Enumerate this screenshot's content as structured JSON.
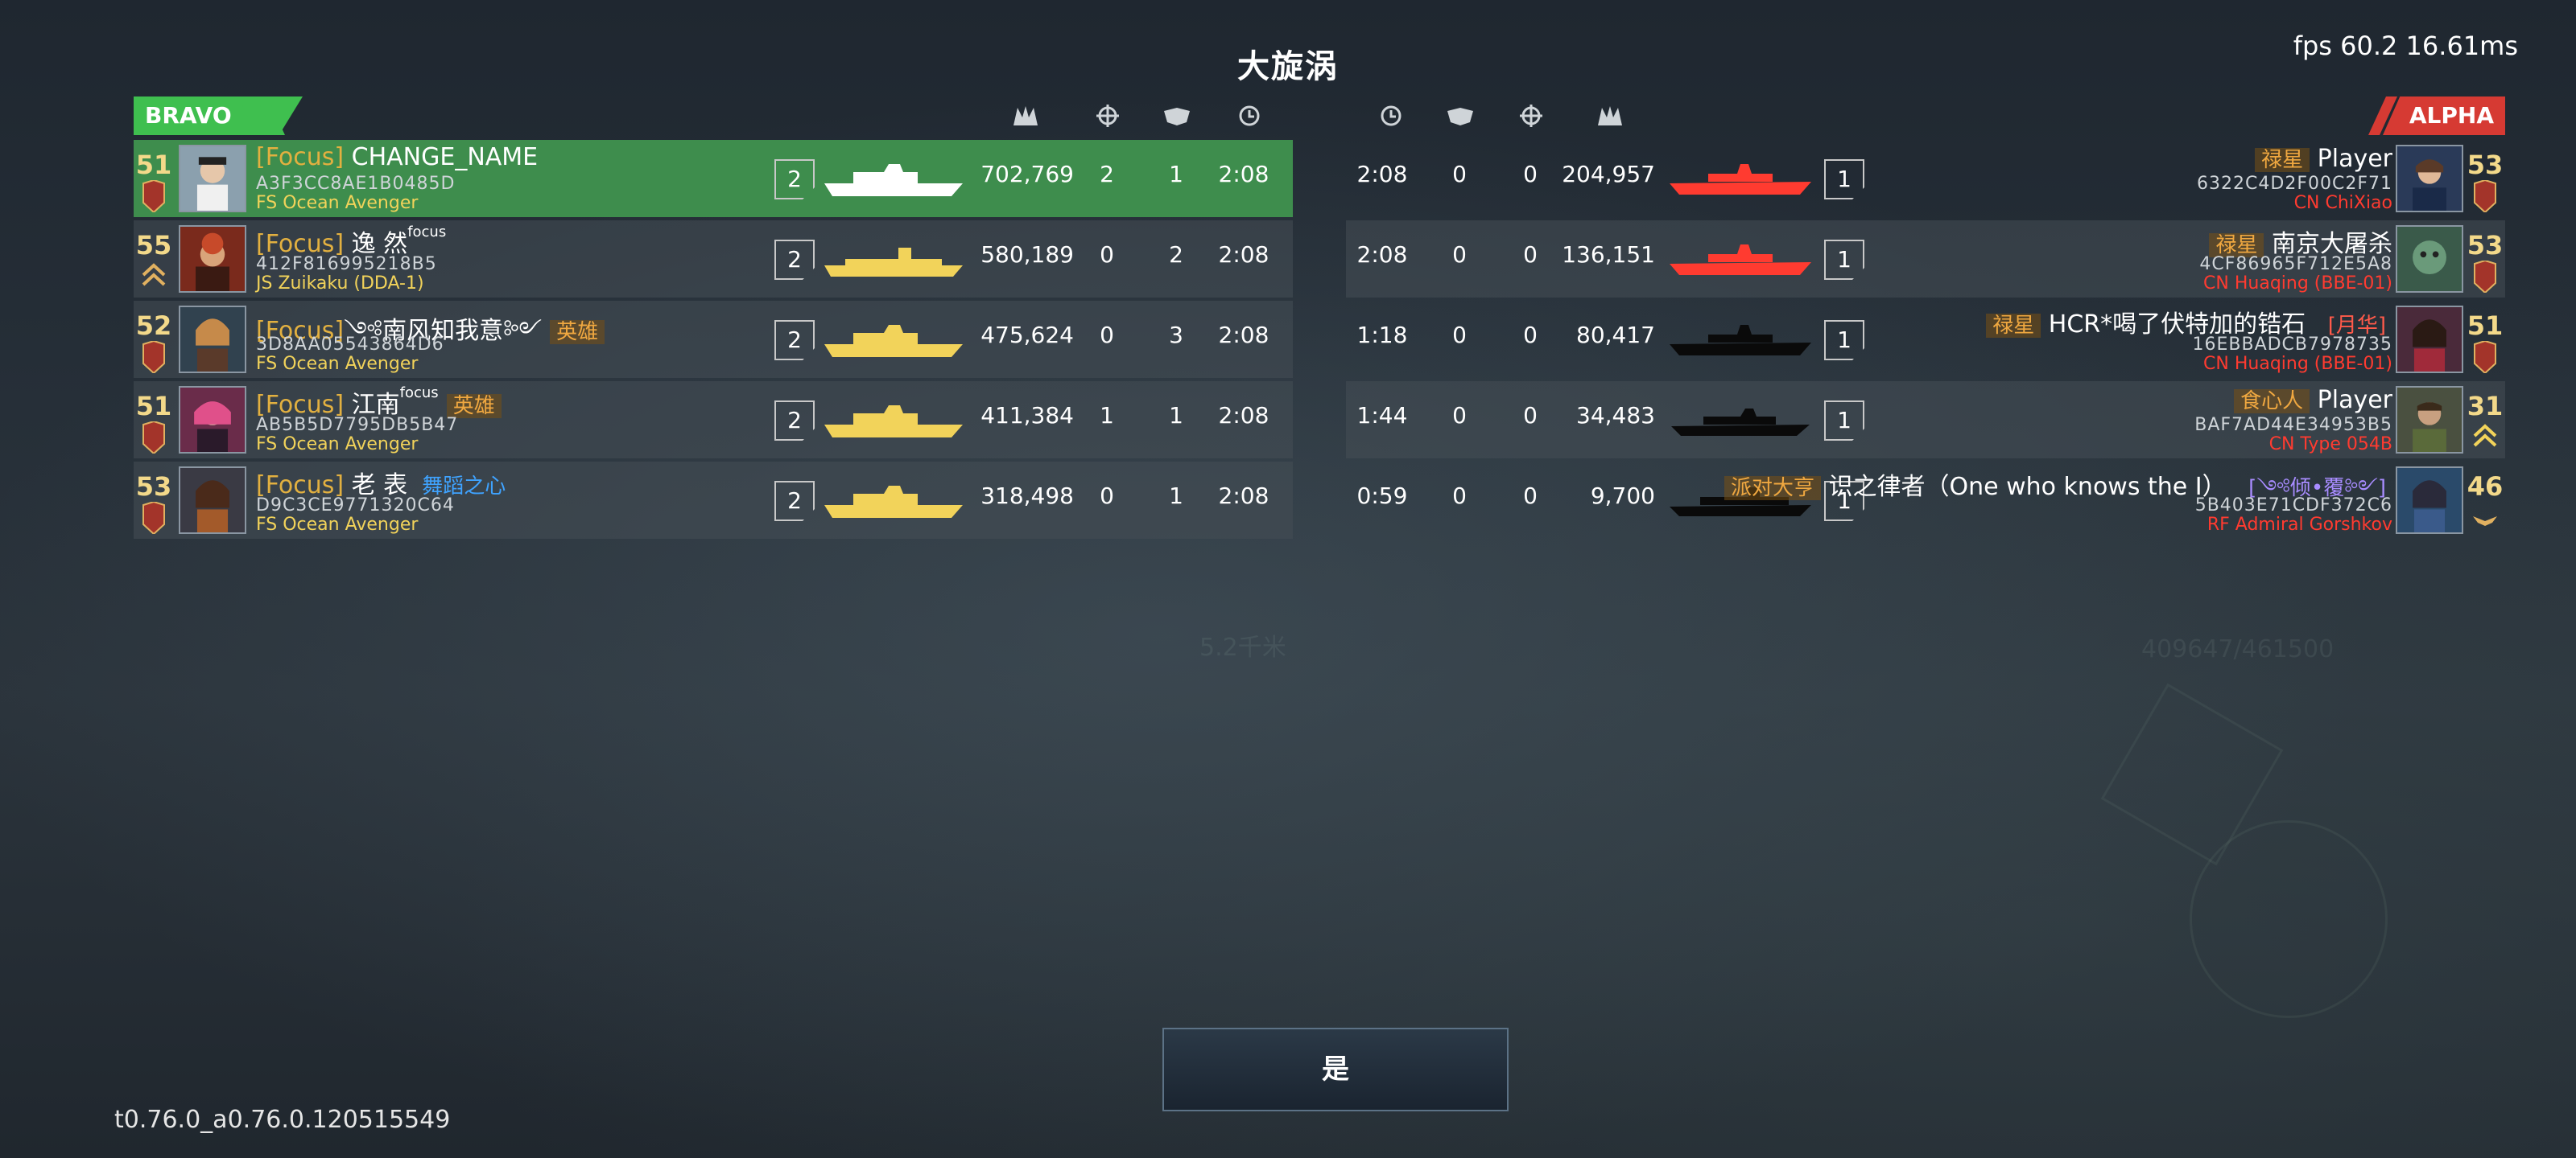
{
  "title": "大旋涡",
  "fps": "fps 60.2  16.61ms",
  "version": "t0.76.0_a0.76.0.120515549",
  "confirm_label": "是",
  "teams": {
    "left": "BRAVO",
    "right": "ALPHA"
  },
  "colors": {
    "bravo": "#3fbf4f",
    "alpha": "#d63a33",
    "focus": "#e2b040",
    "bravo_ship": "#f2d35a",
    "alpha_ship": "#ff3b30"
  },
  "header_icons": [
    "kills-icon",
    "crosshair-icon",
    "assist-icon",
    "clock-icon"
  ],
  "left_players": [
    {
      "level": "51",
      "prefix": "[Focus]",
      "name": "CHANGE_NAME",
      "sup": "",
      "tag": "",
      "id": "A3F3CC8AE1B0485D",
      "ship": "FS Ocean Avenger",
      "count": "2",
      "score": "702,769",
      "stat1": "2",
      "stat2": "1",
      "time": "2:08"
    },
    {
      "level": "55",
      "prefix": "[Focus]",
      "name": "逸 然",
      "sup": "focus",
      "tag": "",
      "id": "412F816995218B5",
      "ship": "JS Zuikaku (DDA-1)",
      "count": "2",
      "score": "580,189",
      "stat1": "0",
      "stat2": "2",
      "time": "2:08"
    },
    {
      "level": "52",
      "prefix": "[Focus]",
      "name": "༺南风知我意༻",
      "sup": "",
      "tag": "英雄",
      "id": "3D8AA05543864D6",
      "ship": "FS Ocean Avenger",
      "count": "2",
      "score": "475,624",
      "stat1": "0",
      "stat2": "3",
      "time": "2:08"
    },
    {
      "level": "51",
      "prefix": "[Focus]",
      "name": "江南",
      "sup": "focus",
      "tag": "英雄",
      "id": "AB5B5D7795DB5B47",
      "ship": "FS Ocean Avenger",
      "count": "2",
      "score": "411,384",
      "stat1": "1",
      "stat2": "1",
      "time": "2:08"
    },
    {
      "level": "53",
      "prefix": "[Focus]",
      "name": "老 表",
      "sup": "",
      "tag": "舞蹈之心",
      "id": "D9C3CE9771320C64",
      "ship": "FS Ocean Avenger",
      "count": "2",
      "score": "318,498",
      "stat1": "0",
      "stat2": "1",
      "time": "2:08"
    }
  ],
  "right_players": [
    {
      "level": "53",
      "tag": "禄星",
      "name": "Player",
      "suffix": "",
      "id": "6322C4D2F00C2F71",
      "ship": "CN ChiXiao",
      "count": "1",
      "score": "204,957",
      "stat1": "0",
      "stat2": "0",
      "time": "2:08"
    },
    {
      "level": "53",
      "tag": "禄星",
      "name": "南京大屠杀",
      "suffix": "",
      "id": "4CF86965F712E5A8",
      "ship": "CN Huaqing (BBE-01)",
      "count": "1",
      "score": "136,151",
      "stat1": "0",
      "stat2": "0",
      "time": "2:08"
    },
    {
      "level": "51",
      "tag": "禄星",
      "name": "HCR*喝了伏特加的锆石",
      "suffix": "[月华]",
      "id": "16EBBADCB7978735",
      "ship": "CN Huaqing (BBE-01)",
      "count": "1",
      "score": "80,417",
      "stat1": "0",
      "stat2": "0",
      "time": "1:18"
    },
    {
      "level": "31",
      "tag": "食心人",
      "name": "Player",
      "suffix": "",
      "id": "BAF7AD44E34953B5",
      "ship": "CN Type 054B",
      "count": "1",
      "score": "34,483",
      "stat1": "0",
      "stat2": "0",
      "time": "1:44"
    },
    {
      "level": "46",
      "tag": "派对大亨",
      "name": "识之律者（One who knows the I）",
      "suffix": "[༺倾•覆༻]",
      "id": "5B403E71CDF372C6",
      "ship": "RF Admiral Gorshkov",
      "count": "1",
      "score": "9,700",
      "stat1": "0",
      "stat2": "0",
      "time": "0:59"
    }
  ]
}
